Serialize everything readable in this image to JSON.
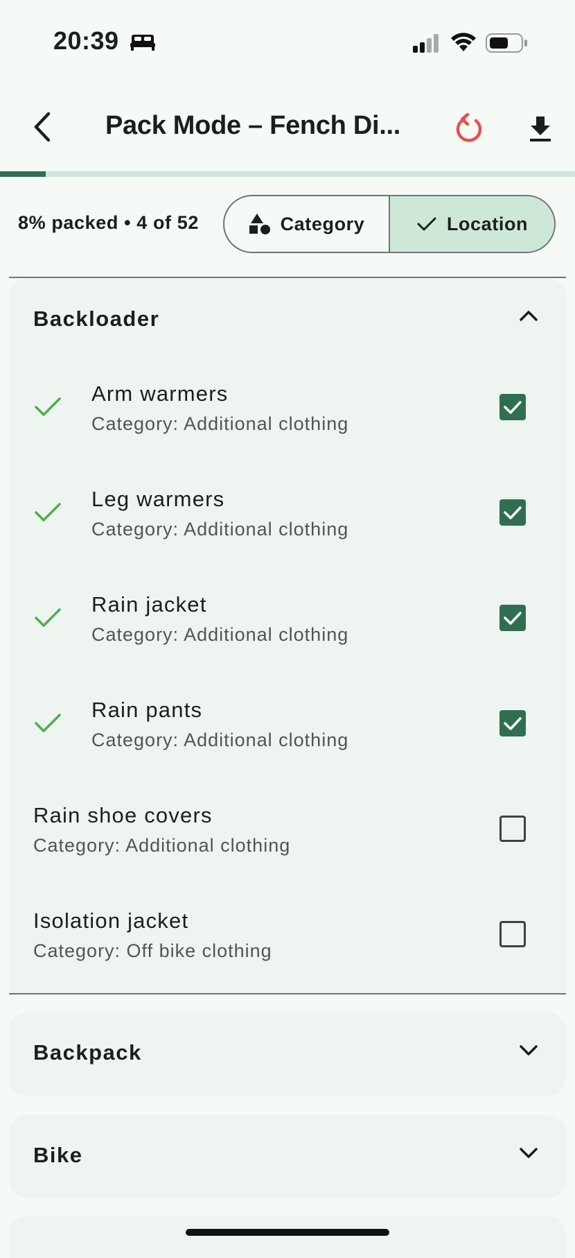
{
  "status_bar": {
    "time": "20:39"
  },
  "app_bar": {
    "title": "Pack Mode – Fench Di..."
  },
  "progress": {
    "fraction": 0.08
  },
  "summary": {
    "text": "8% packed • 4 of 52"
  },
  "grouping": {
    "category_label": "Category",
    "location_label": "Location",
    "selected": "Location"
  },
  "colors": {
    "accent": "#2f6f4f",
    "checkmark": "#4caf50",
    "reset": "#e8504f",
    "selected_segment": "#cde8d7",
    "background": "#f5faf6",
    "card": "#eef5f0"
  },
  "sections": {
    "backloader": {
      "title": "Backloader",
      "items": [
        {
          "name": "Arm warmers",
          "category": "Category: Additional clothing",
          "packed": true
        },
        {
          "name": "Leg warmers",
          "category": "Category: Additional clothing",
          "packed": true
        },
        {
          "name": "Rain jacket",
          "category": "Category: Additional clothing",
          "packed": true
        },
        {
          "name": "Rain pants",
          "category": "Category: Additional clothing",
          "packed": true
        },
        {
          "name": "Rain shoe covers",
          "category": "Category: Additional clothing",
          "packed": false
        },
        {
          "name": "Isolation jacket",
          "category": "Category: Off bike clothing",
          "packed": false
        }
      ]
    },
    "backpack": {
      "title": "Backpack"
    },
    "bike": {
      "title": "Bike"
    }
  },
  "icons": [
    "bed-icon",
    "signal-icon",
    "wifi-icon",
    "battery-icon",
    "back-arrow-icon",
    "reset-icon",
    "download-icon",
    "shapes-icon",
    "check-icon",
    "chevron-up-icon",
    "chevron-down-icon"
  ]
}
